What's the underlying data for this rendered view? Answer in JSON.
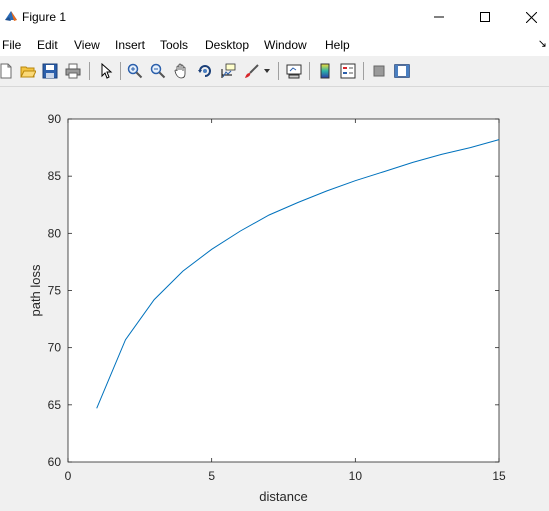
{
  "window": {
    "title": "Figure 1",
    "controls": [
      "minimize",
      "maximize",
      "close"
    ]
  },
  "menu": {
    "items": [
      "File",
      "Edit",
      "View",
      "Insert",
      "Tools",
      "Desktop",
      "Window",
      "Help"
    ]
  },
  "toolbar": {
    "buttons": [
      "new-figure-icon",
      "open-file-icon",
      "save-icon",
      "print-icon",
      "pointer-icon",
      "zoom-in-icon",
      "zoom-out-icon",
      "pan-icon",
      "rotate-3d-icon",
      "data-cursor-icon",
      "brush-icon",
      "link-plot-icon",
      "colorbar-icon",
      "legend-icon",
      "hide-plot-tools-icon",
      "show-plot-tools-icon"
    ]
  },
  "chart_data": {
    "type": "line",
    "title": "",
    "xlabel": "distance",
    "ylabel": "path loss",
    "xlim": [
      0,
      15
    ],
    "ylim": [
      60,
      90
    ],
    "xticks": [
      0,
      5,
      10,
      15
    ],
    "yticks": [
      60,
      65,
      70,
      75,
      80,
      85,
      90
    ],
    "grid": false,
    "series": [
      {
        "color": "#0072bd",
        "x": [
          1,
          2,
          3,
          4,
          5,
          6,
          7,
          8,
          9,
          10,
          11,
          12,
          13,
          14,
          15
        ],
        "y": [
          64.7,
          70.7,
          74.2,
          76.7,
          78.6,
          80.2,
          81.6,
          82.7,
          83.7,
          84.6,
          85.4,
          86.2,
          86.9,
          87.5,
          88.2
        ]
      }
    ]
  }
}
